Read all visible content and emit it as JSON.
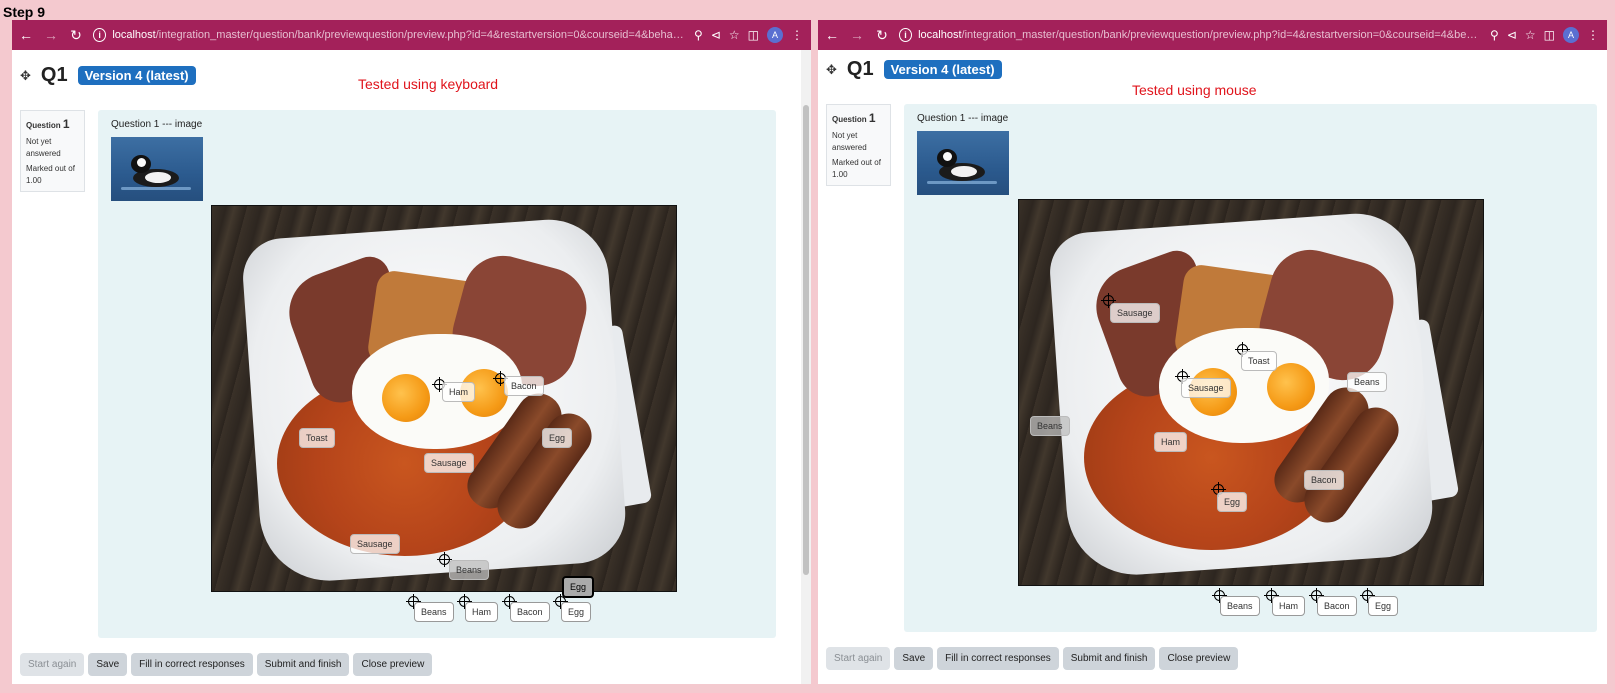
{
  "step_label": "Step 9",
  "panels": {
    "left": {
      "url_host": "localhost",
      "url_path": "/integration_master/question/bank/previewquestion/preview.php?id=4&restartversion=0&courseid=4&behaviour=d...",
      "avatar": "A",
      "q_title": "Q1",
      "version": "Version 4 (latest)",
      "tested_note": "Tested using keyboard",
      "info": {
        "question_label": "Question",
        "question_number": "1",
        "state": "Not yet answered",
        "marks": "Marked out of 1.00"
      },
      "question_text": "Question 1 --- image",
      "tags": {
        "ham": "Ham",
        "bacon": "Bacon",
        "toast": "Toast",
        "egg": "Egg",
        "sausage1": "Sausage",
        "sausage2": "Sausage",
        "beans": "Beans",
        "egg_focused": "Egg"
      },
      "home": [
        "Beans",
        "Ham",
        "Bacon",
        "Egg"
      ],
      "buttons": [
        "Start again",
        "Save",
        "Fill in correct responses",
        "Submit and finish",
        "Close preview"
      ]
    },
    "right": {
      "url_host": "localhost",
      "url_path": "/integration_master/question/bank/previewquestion/preview.php?id=4&restartversion=0&courseid=4&behaviour=d...",
      "avatar": "A",
      "q_title": "Q1",
      "version": "Version 4 (latest)",
      "tested_note": "Tested using mouse",
      "info": {
        "question_label": "Question",
        "question_number": "1",
        "state": "Not yet answered",
        "marks": "Marked out of 1.00"
      },
      "question_text": "Question 1 --- image",
      "tags": {
        "sausage1": "Sausage",
        "toast": "Toast",
        "sausage2": "Sausage",
        "beans_on_plate": "Beans",
        "beans_outside": "Beans",
        "ham": "Ham",
        "bacon": "Bacon",
        "egg": "Egg"
      },
      "home": [
        "Beans",
        "Ham",
        "Bacon",
        "Egg"
      ],
      "buttons": [
        "Start again",
        "Save",
        "Fill in correct responses",
        "Submit and finish",
        "Close preview"
      ]
    }
  }
}
